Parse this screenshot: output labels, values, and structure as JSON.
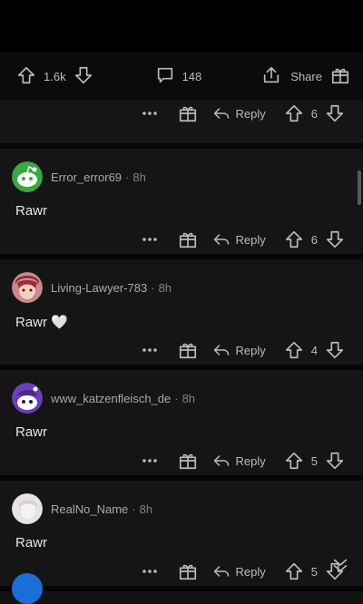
{
  "post_bar": {
    "score": "1.6k",
    "comment_count": "148",
    "share_label": "Share"
  },
  "first_comment": {
    "score": "6",
    "reply_label": "Reply"
  },
  "comments": [
    {
      "username": "Error_error69",
      "time": "8h",
      "body": "Rawr",
      "score": "6",
      "reply_label": "Reply",
      "avatar": "green-robot-avatar"
    },
    {
      "username": "Living-Lawyer-783",
      "time": "8h",
      "body": "Rawr 🤍",
      "score": "4",
      "reply_label": "Reply",
      "avatar": "anime-avatar"
    },
    {
      "username": "www_katzenfleisch_de",
      "time": "8h",
      "body": "Rawr",
      "score": "5",
      "reply_label": "Reply",
      "avatar": "purple-snoo-avatar"
    },
    {
      "username": "RealNo_Name",
      "time": "8h",
      "body": "Rawr",
      "score": "5",
      "reply_label": "Reply",
      "avatar": "white-avatar"
    }
  ],
  "separator": "·",
  "colors": {
    "background": "#000000",
    "card": "#151516",
    "text": "#d7dadc",
    "muted": "#818384"
  }
}
